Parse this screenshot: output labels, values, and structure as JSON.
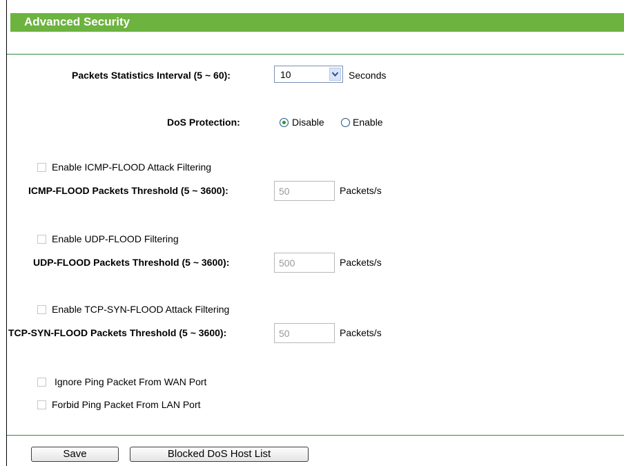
{
  "header": {
    "title": "Advanced Security"
  },
  "packets_interval": {
    "label": "Packets Statistics Interval (5 ~ 60):",
    "value": "10",
    "unit": "Seconds"
  },
  "dos_protection": {
    "label": "DoS Protection:",
    "options": [
      "Disable",
      "Enable"
    ],
    "selected": "Disable"
  },
  "icmp": {
    "enable_label": "Enable ICMP-FLOOD Attack Filtering",
    "threshold_label": "ICMP-FLOOD Packets Threshold (5 ~ 3600):",
    "value": "50",
    "unit": "Packets/s"
  },
  "udp": {
    "enable_label": "Enable UDP-FLOOD Filtering",
    "threshold_label": "UDP-FLOOD Packets Threshold (5 ~ 3600):",
    "value": "500",
    "unit": "Packets/s"
  },
  "tcp": {
    "enable_label": "Enable TCP-SYN-FLOOD Attack Filtering",
    "threshold_label": "TCP-SYN-FLOOD Packets Threshold (5 ~ 3600):",
    "value": "50",
    "unit": "Packets/s"
  },
  "ping": {
    "ignore_wan_label": "Ignore Ping Packet From WAN Port",
    "forbid_lan_label": "Forbid Ping Packet From LAN Port"
  },
  "buttons": {
    "save": "Save",
    "blocked_list": "Blocked DoS Host List"
  }
}
